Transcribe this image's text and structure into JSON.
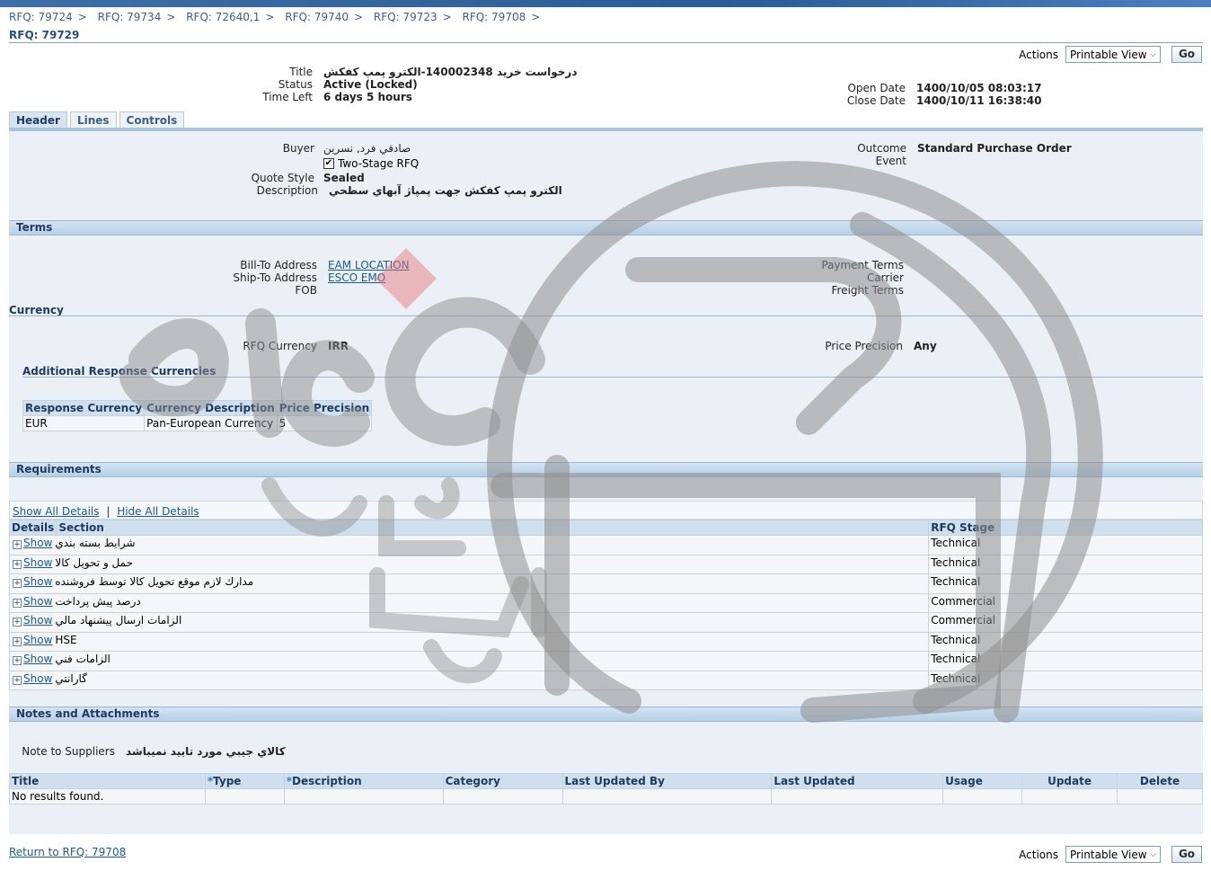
{
  "breadcrumbs": [
    "RFQ: 79724",
    "RFQ: 79734",
    "RFQ: 72640,1",
    "RFQ: 79740",
    "RFQ: 79723",
    "RFQ: 79708"
  ],
  "breadcrumb_separator": ">",
  "current_rfq": "RFQ: 79729",
  "actions": {
    "label": "Actions",
    "selected": "Printable View",
    "go": "Go"
  },
  "summary": {
    "title_label": "Title",
    "title_value": "درخواست خريد 140002348-الکترو پمپ کفکش",
    "status_label": "Status",
    "status_value": "Active (Locked)",
    "time_left_label": "Time Left",
    "time_left_value": "6 days 5 hours",
    "open_date_label": "Open Date",
    "open_date_value": "1400/10/05 08:03:17",
    "close_date_label": "Close Date",
    "close_date_value": "1400/10/11 16:38:40"
  },
  "tabs": [
    "Header",
    "Lines",
    "Controls"
  ],
  "header": {
    "buyer_label": "Buyer",
    "buyer_value": "صادقي فرد, نسرين",
    "two_stage_label": "Two-Stage RFQ",
    "two_stage_checked": true,
    "quote_style_label": "Quote Style",
    "quote_style_value": "Sealed",
    "description_label": "Description",
    "description_value": "الكترو پمپ كفكش جهت پمپاژ آبهاي سطحي",
    "outcome_label": "Outcome",
    "outcome_value": "Standard Purchase Order",
    "event_label": "Event"
  },
  "terms": {
    "heading": "Terms",
    "bill_to_label": "Bill-To Address",
    "bill_to_value": "EAM LOCATION",
    "ship_to_label": "Ship-To Address",
    "ship_to_value": "ESCO EMO",
    "fob_label": "FOB",
    "payment_terms_label": "Payment Terms",
    "carrier_label": "Carrier",
    "freight_terms_label": "Freight Terms"
  },
  "currency": {
    "heading": "Currency",
    "rfq_currency_label": "RFQ Currency",
    "rfq_currency_value": "IRR",
    "price_precision_label": "Price Precision",
    "price_precision_value": "Any",
    "additional_heading": "Additional Response Currencies",
    "columns": [
      "Response Currency",
      "Currency Description",
      "Price Precision"
    ],
    "rows": [
      [
        "EUR",
        "Pan-European Currency",
        "5"
      ]
    ]
  },
  "requirements": {
    "heading": "Requirements",
    "show_all": "Show All Details",
    "hide_all": "Hide All Details",
    "columns": [
      "Details",
      "Section",
      "RFQ Stage"
    ],
    "show_label": "Show",
    "rows": [
      {
        "section": "شرايط بسته بندي",
        "stage": "Technical"
      },
      {
        "section": "حمل و تحويل كالا",
        "stage": "Technical"
      },
      {
        "section": "مدارك لازم موقع تحويل كالا توسط فروشنده",
        "stage": "Technical"
      },
      {
        "section": "درصد پيش پرداخت",
        "stage": "Commercial"
      },
      {
        "section": "الزامات ارسال پيشنهاد مالي",
        "stage": "Commercial"
      },
      {
        "section": "HSE",
        "stage": "Technical"
      },
      {
        "section": "الزامات فني",
        "stage": "Technical"
      },
      {
        "section": "گارانتي",
        "stage": "Technical"
      }
    ]
  },
  "notes": {
    "heading": "Notes and Attachments",
    "note_label": "Note to Suppliers",
    "note_value": "كالاي جيبي مورد تاييد نميباشد",
    "columns": [
      "Title",
      "Type",
      "Description",
      "Category",
      "Last Updated By",
      "Last Updated",
      "Usage",
      "Update",
      "Delete"
    ],
    "required_marker": "*",
    "empty_text": "No results found."
  },
  "footer": {
    "return_link": "Return to RFQ: 79708"
  }
}
